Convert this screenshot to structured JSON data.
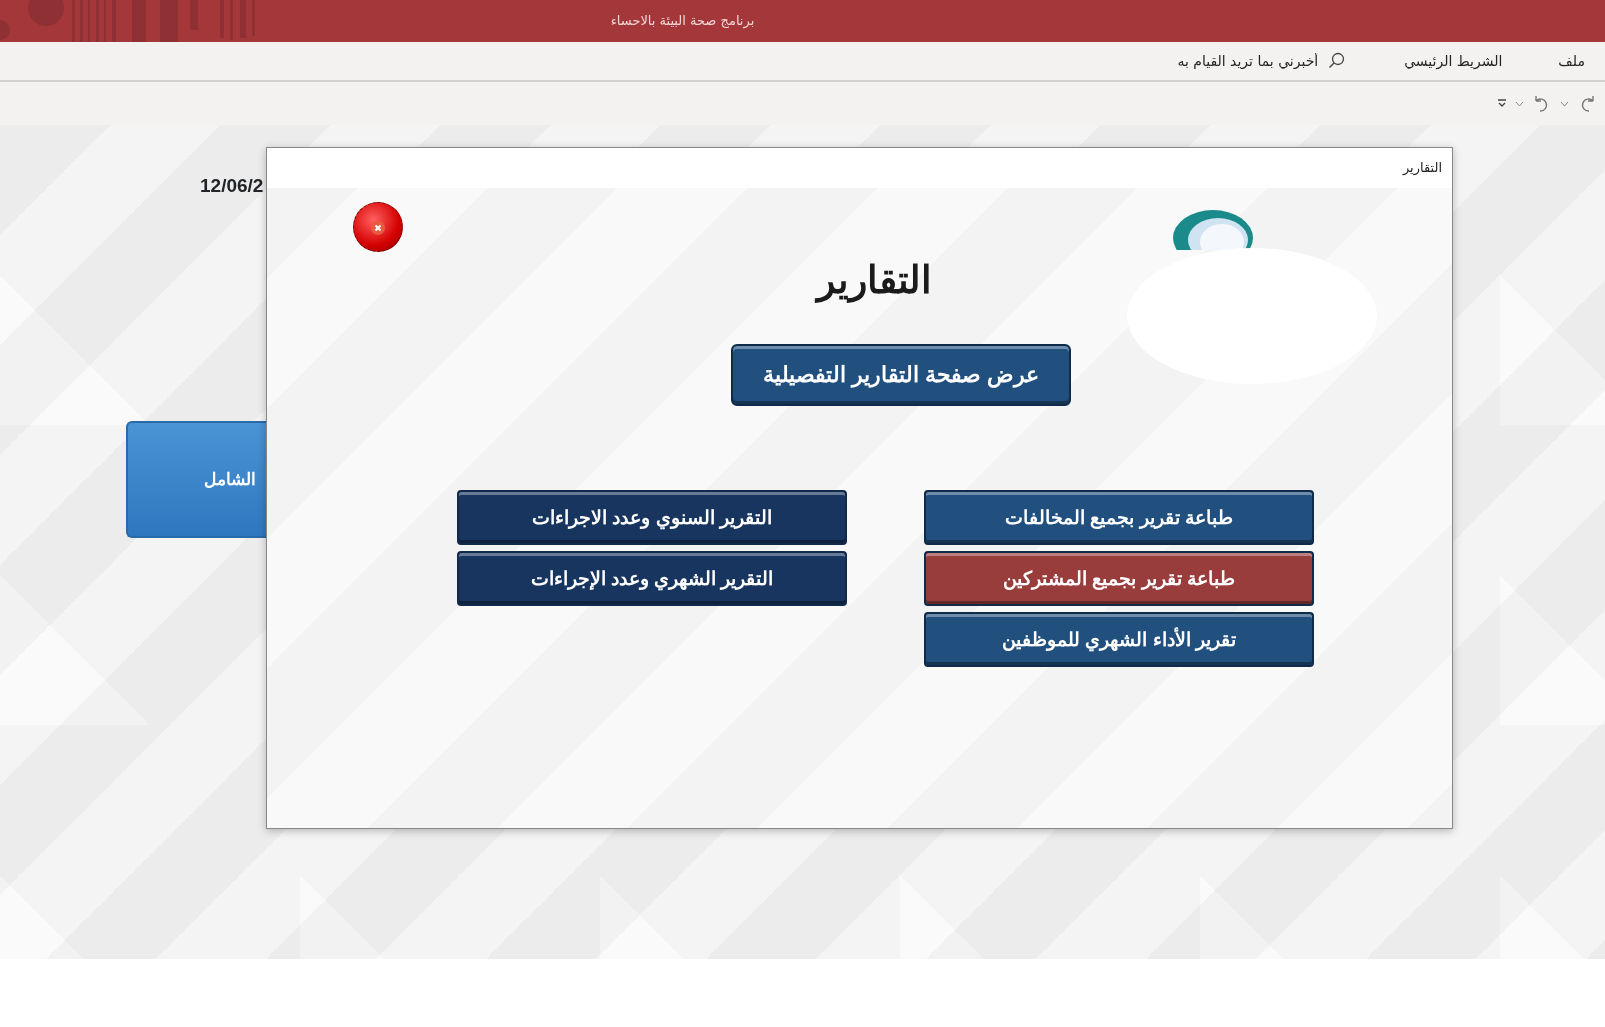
{
  "window": {
    "title": "برنامج صحة البيئة بالاحساء"
  },
  "ribbon": {
    "tabs": [
      {
        "label": "ملف",
        "selected": false
      },
      {
        "label": "الشريط الرئيسي",
        "selected": false
      }
    ],
    "tell_me": {
      "placeholder": "أخبرني بما تريد القيام به"
    }
  },
  "background_form": {
    "date": "12/06/2",
    "button": "الشامل"
  },
  "dialog": {
    "title": "التقارير",
    "heading": "التقارير",
    "main_button": "عرض صفحة التقارير التفصيلية",
    "right_buttons": [
      {
        "label": "طباعة تقرير بجميع المخالفات",
        "kind": "medium",
        "highlighted": false
      },
      {
        "label": "طباعة تقرير بجميع المشتركين",
        "kind": "medium",
        "highlighted": true
      },
      {
        "label": "تقرير الأداء الشهري للموظفين",
        "kind": "medium",
        "highlighted": false
      }
    ],
    "left_buttons": [
      {
        "label": "التقرير السنوي وعدد الاجراءات",
        "kind": "dark",
        "highlighted": false
      },
      {
        "label": "التقرير الشهري وعدد الإجراءات",
        "kind": "dark",
        "highlighted": false
      }
    ]
  }
}
